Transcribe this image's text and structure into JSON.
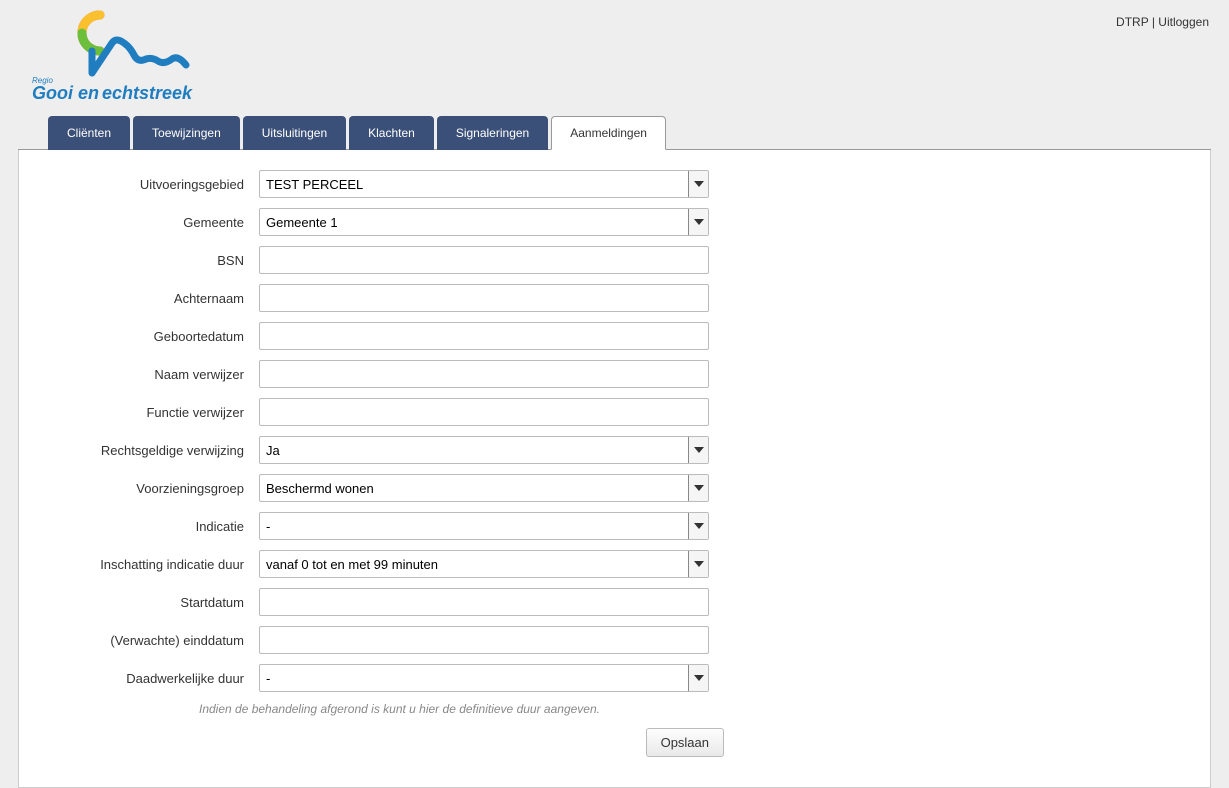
{
  "header": {
    "user_label": "DTRP",
    "separator": " | ",
    "logout_label": "Uitloggen",
    "logo_text_left": "Gooi en",
    "logo_text_right": "echtstreek",
    "logo_regio": "Regio"
  },
  "tabs": [
    {
      "label": "Cliënten",
      "active": false
    },
    {
      "label": "Toewijzingen",
      "active": false
    },
    {
      "label": "Uitsluitingen",
      "active": false
    },
    {
      "label": "Klachten",
      "active": false
    },
    {
      "label": "Signaleringen",
      "active": false
    },
    {
      "label": "Aanmeldingen",
      "active": true
    }
  ],
  "form": {
    "uitvoeringsgebied": {
      "label": "Uitvoeringsgebied",
      "value": "TEST PERCEEL"
    },
    "gemeente": {
      "label": "Gemeente",
      "value": "Gemeente 1"
    },
    "bsn": {
      "label": "BSN",
      "value": ""
    },
    "achternaam": {
      "label": "Achternaam",
      "value": ""
    },
    "geboortedatum": {
      "label": "Geboortedatum",
      "value": ""
    },
    "naam_verwijzer": {
      "label": "Naam verwijzer",
      "value": ""
    },
    "functie_verwijzer": {
      "label": "Functie verwijzer",
      "value": ""
    },
    "rechtsgeldige_verwijzing": {
      "label": "Rechtsgeldige verwijzing",
      "value": "Ja"
    },
    "voorzieningsgroep": {
      "label": "Voorzieningsgroep",
      "value": "Beschermd wonen"
    },
    "indicatie": {
      "label": "Indicatie",
      "value": "-"
    },
    "inschatting_indicatie_duur": {
      "label": "Inschatting indicatie duur",
      "value": "vanaf 0 tot en met 99 minuten"
    },
    "startdatum": {
      "label": "Startdatum",
      "value": ""
    },
    "verwachte_einddatum": {
      "label": "(Verwachte) einddatum",
      "value": ""
    },
    "daadwerkelijke_duur": {
      "label": "Daadwerkelijke duur",
      "value": "-"
    },
    "help_text": "Indien de behandeling afgerond is kunt u hier de definitieve duur aangeven.",
    "save_label": "Opslaan"
  }
}
